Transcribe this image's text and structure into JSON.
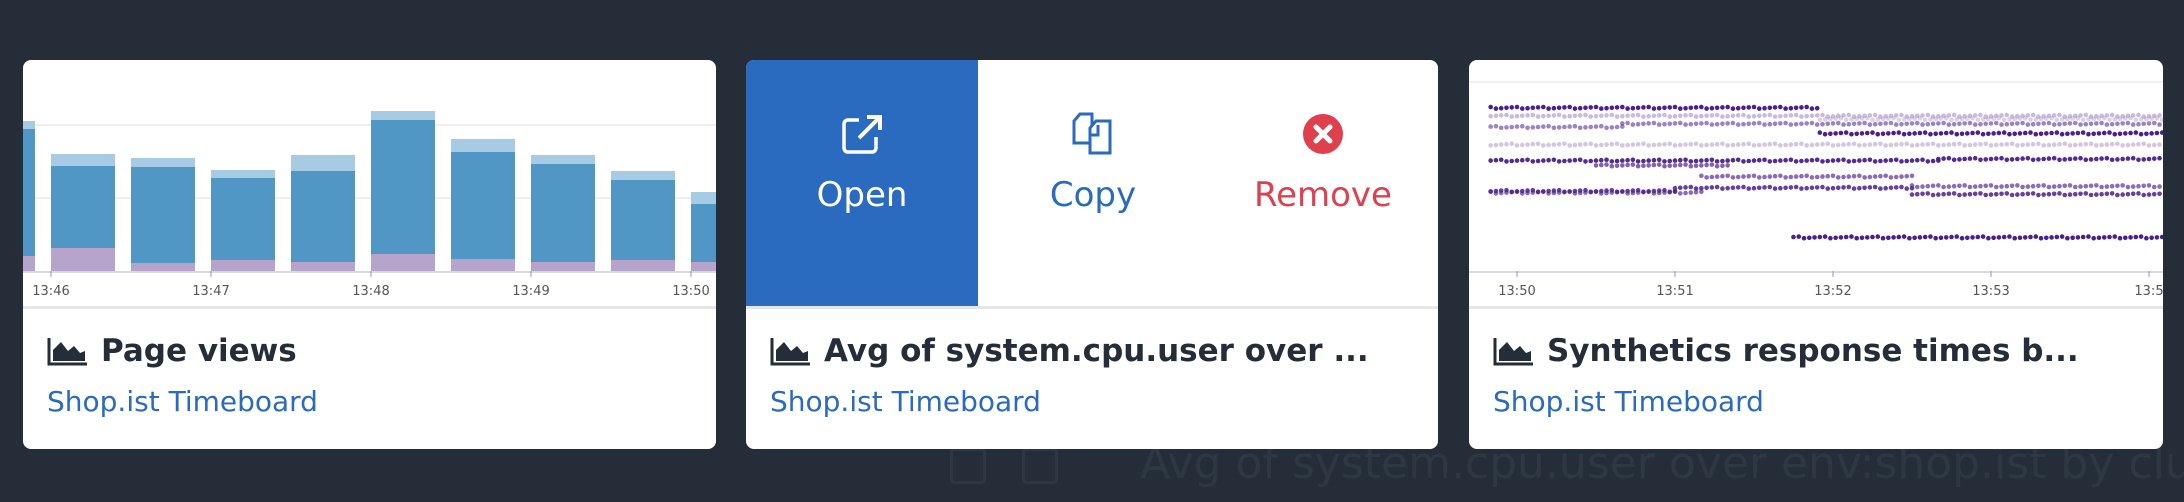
{
  "background_text": "Avg of system.cpu.user over env:shop.ist by cluste",
  "colors": {
    "link": "#2a6bbf",
    "open_bg": "#2b6bbf",
    "remove": "#e0404e",
    "bar_main": "#5197c6",
    "bar_top": "#a6cbe3",
    "bar_base": "#b7a4cd",
    "dots": "#4b1f8f"
  },
  "cards": [
    {
      "title": "Page views",
      "title_icon": "area-chart-icon",
      "subtitle": "Shop.ist Timeboard",
      "chart_data": {
        "type": "bar",
        "stacked": true,
        "x_ticks": [
          "13:46",
          "13:47",
          "13:48",
          "13:49",
          "13:50"
        ],
        "categories": [
          "13:45:30",
          "13:46:00",
          "13:46:30",
          "13:47:00",
          "13:47:30",
          "13:48:00",
          "13:48:30",
          "13:49:00",
          "13:49:30",
          "13:50:00"
        ],
        "series": [
          {
            "values": [
              15,
              23,
              8,
              11,
              9,
              17,
              12,
              9,
              11,
              9
            ]
          },
          {
            "values": [
              127,
              82,
              96,
              82,
              91,
              134,
              107,
              98,
              80,
              58
            ]
          },
          {
            "values": [
              8,
              12,
              9,
              8,
              16,
              9,
              13,
              9,
              9,
              12
            ]
          }
        ],
        "grid": true
      }
    },
    {
      "title": "Avg of system.cpu.user over ...",
      "title_icon": "area-chart-icon",
      "subtitle": "Shop.ist Timeboard",
      "actions": [
        {
          "label": "Open",
          "icon": "external-link-icon"
        },
        {
          "label": "Copy",
          "icon": "copy-icon"
        },
        {
          "label": "Remove",
          "icon": "remove-circle-icon"
        }
      ]
    },
    {
      "title": "Synthetics response times b...",
      "title_icon": "area-chart-icon",
      "subtitle": "Shop.ist Timeboard",
      "chart_data": {
        "type": "scatter",
        "x_ticks": [
          "13:50",
          "13:51",
          "13:52",
          "13:53",
          "13:5"
        ],
        "series": [
          {
            "opacity": 1.0,
            "segments": [
              [
                "13:49:50",
                "13:51:55",
                102
              ],
              [
                "13:51:55",
                "13:54:10",
                86
              ]
            ]
          },
          {
            "opacity": 0.3,
            "segments": [
              [
                "13:49:50",
                "13:54:10",
                97
              ]
            ]
          },
          {
            "opacity": 0.55,
            "segments": [
              [
                "13:49:50",
                "13:50:40",
                90
              ],
              [
                "13:50:40",
                "13:54:10",
                92
              ]
            ]
          },
          {
            "opacity": 0.25,
            "segments": [
              [
                "13:49:50",
                "13:54:10",
                79
              ]
            ]
          },
          {
            "opacity": 0.95,
            "segments": [
              [
                "13:49:50",
                "13:52:40",
                69
              ],
              [
                "13:52:40",
                "13:54:10",
                70
              ]
            ]
          },
          {
            "opacity": 0.65,
            "segments": [
              [
                "13:49:50",
                "13:51:10",
                49
              ],
              [
                "13:51:10",
                "13:52:30",
                59
              ],
              [
                "13:52:30",
                "13:54:10",
                53
              ]
            ]
          },
          {
            "opacity": 0.85,
            "segments": [
              [
                "13:49:50",
                "13:51:00",
                50
              ],
              [
                "13:51:00",
                "13:52:30",
                52
              ],
              [
                "13:52:30",
                "13:54:10",
                48
              ]
            ]
          },
          {
            "opacity": 1.0,
            "segments": [
              [
                "13:51:45",
                "13:54:10",
                21
              ]
            ]
          },
          {
            "opacity": 0.2,
            "segments": [
              [
                "13:51:55",
                "13:54:10",
                95
              ]
            ]
          },
          {
            "opacity": 0.7,
            "segments": [
              [
                "13:50:30",
                "13:51:20",
                66
              ]
            ]
          }
        ]
      }
    }
  ]
}
